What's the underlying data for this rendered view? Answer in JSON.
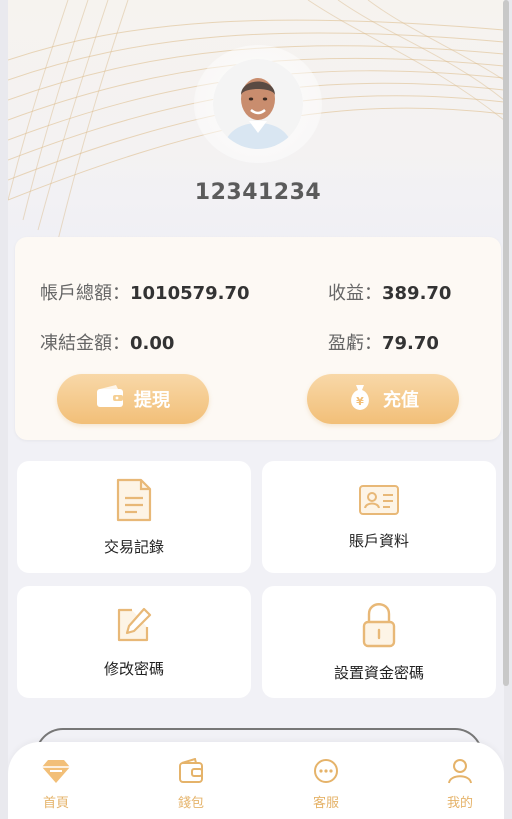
{
  "profile": {
    "username": "12341234"
  },
  "account": {
    "total_label": "帳戶總額：",
    "total_value": "1010579.70",
    "income_label": "收益：",
    "income_value": "389.70",
    "frozen_label": "凍結金額：",
    "frozen_value": "0.00",
    "pnl_label": "盈虧：",
    "pnl_value": "79.70",
    "withdraw_label": "提現",
    "recharge_label": "充值",
    "recharge_icon_glyph": "¥"
  },
  "menu": {
    "transactions": "交易記錄",
    "account_info": "賬戶資料",
    "change_password": "修改密碼",
    "fund_password": "設置資金密碼"
  },
  "tabbar": {
    "home": "首頁",
    "wallet": "錢包",
    "service": "客服",
    "mine": "我的"
  },
  "colors": {
    "accent": "#f2bf78",
    "tab_label": "#e5b36a",
    "card_bg": "#fdf9f4"
  },
  "icons": [
    "wallet-icon",
    "money-bag-icon",
    "document-icon",
    "id-card-icon",
    "edit-icon",
    "lock-icon",
    "diamond-icon",
    "wallet-tab-icon",
    "chat-icon",
    "user-icon"
  ]
}
